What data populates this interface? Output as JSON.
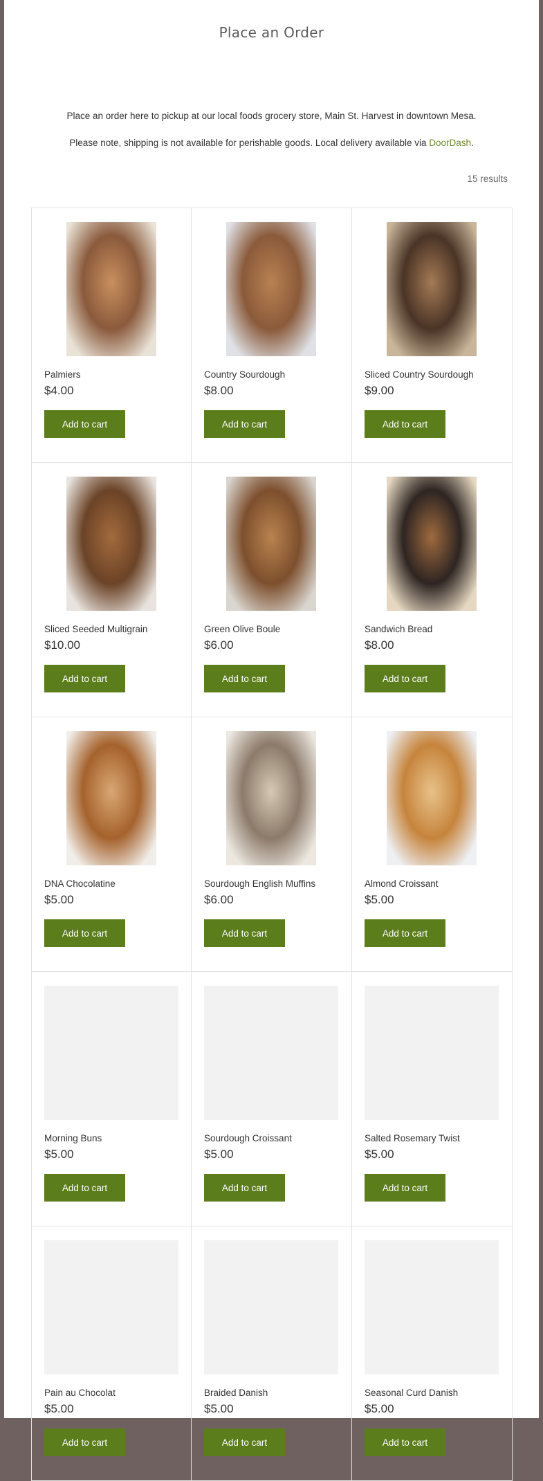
{
  "header": {
    "cutoff_text": "",
    "title": "Place an Order"
  },
  "intro": {
    "line1": "Place an order here to pickup at our local foods grocery store, Main St. Harvest in downtown Mesa.",
    "line2_prefix": "Please note, shipping is not available for perishable goods. Local delivery available via ",
    "line2_link": "DoorDash",
    "line2_suffix": "."
  },
  "results": {
    "count_label": "15 results"
  },
  "button_label": "Add to cart",
  "products": [
    {
      "name": "Palmiers",
      "price": "$4.00",
      "has_image": true,
      "image_icon": "palmiers-photo",
      "colors": [
        "#8a5a3c",
        "#c98f5e",
        "#e9e2d6"
      ]
    },
    {
      "name": "Country Sourdough",
      "price": "$8.00",
      "has_image": true,
      "image_icon": "country-sourdough-photo",
      "colors": [
        "#8a5a3a",
        "#b98152",
        "#dfe1e6"
      ]
    },
    {
      "name": "Sliced Country Sourdough",
      "price": "$9.00",
      "has_image": true,
      "image_icon": "sliced-sourdough-photo",
      "colors": [
        "#4a3426",
        "#a47a55",
        "#c9b69a"
      ]
    },
    {
      "name": "Sliced Seeded Multigrain",
      "price": "$10.00",
      "has_image": true,
      "image_icon": "seeded-multigrain-photo",
      "colors": [
        "#6b4327",
        "#a36a3d",
        "#e8e3de"
      ]
    },
    {
      "name": "Green Olive Boule",
      "price": "$6.00",
      "has_image": true,
      "image_icon": "olive-boule-photo",
      "colors": [
        "#7d4f2d",
        "#b9834f",
        "#d9d5cf"
      ]
    },
    {
      "name": "Sandwich Bread",
      "price": "$8.00",
      "has_image": true,
      "image_icon": "sandwich-bread-photo",
      "colors": [
        "#2e2522",
        "#9f6a3e",
        "#e5d7c0"
      ]
    },
    {
      "name": "DNA Chocolatine",
      "price": "$5.00",
      "has_image": true,
      "image_icon": "chocolatine-photo",
      "colors": [
        "#a5622c",
        "#d9a775",
        "#f1ede8"
      ]
    },
    {
      "name": "Sourdough English Muffins",
      "price": "$6.00",
      "has_image": true,
      "image_icon": "english-muffins-photo",
      "colors": [
        "#8c7a6a",
        "#d6c9b3",
        "#ece8e0"
      ]
    },
    {
      "name": "Almond Croissant",
      "price": "$5.00",
      "has_image": true,
      "image_icon": "almond-croissant-photo",
      "colors": [
        "#c6843c",
        "#e8c28a",
        "#eef0f4"
      ]
    },
    {
      "name": "Morning Buns",
      "price": "$5.00",
      "has_image": false
    },
    {
      "name": "Sourdough Croissant",
      "price": "$5.00",
      "has_image": false
    },
    {
      "name": "Salted Rosemary Twist",
      "price": "$5.00",
      "has_image": false
    },
    {
      "name": "Pain au Chocolat",
      "price": "$5.00",
      "has_image": false
    },
    {
      "name": "Braided Danish",
      "price": "$5.00",
      "has_image": false
    },
    {
      "name": "Seasonal Curd Danish",
      "price": "$5.00",
      "has_image": false
    }
  ]
}
